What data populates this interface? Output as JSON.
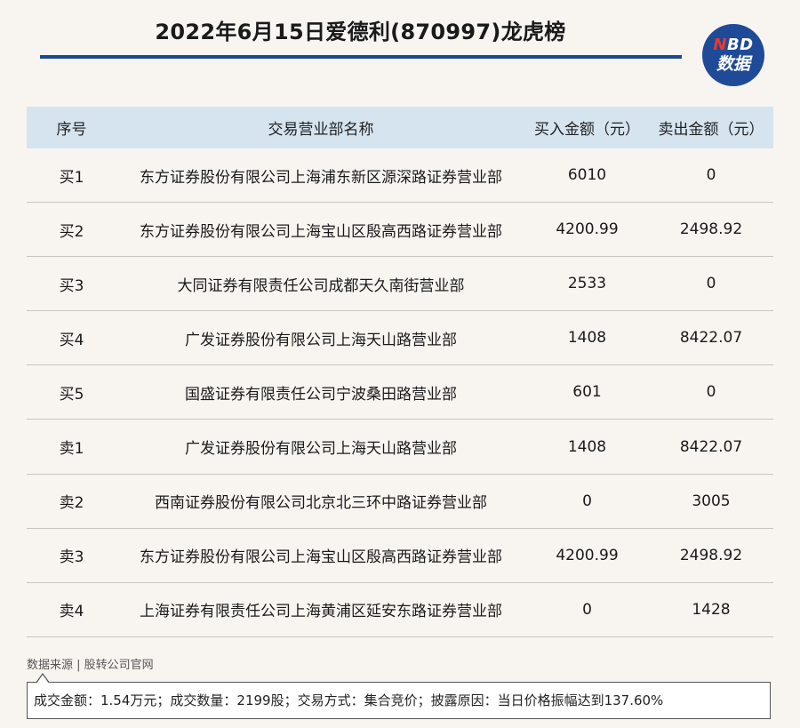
{
  "title": "2022年6月15日爱德利(870997)龙虎榜",
  "logo": {
    "n": "N",
    "bd": "BD",
    "sub": "数据"
  },
  "table": {
    "headers": [
      "序号",
      "交易营业部名称",
      "买入金额（元）",
      "卖出金额（元）"
    ],
    "rows": [
      {
        "seq": "买1",
        "name": "东方证券股份有限公司上海浦东新区源深路证券营业部",
        "buy": "6010",
        "sell": "0"
      },
      {
        "seq": "买2",
        "name": "东方证券股份有限公司上海宝山区殷高西路证券营业部",
        "buy": "4200.99",
        "sell": "2498.92"
      },
      {
        "seq": "买3",
        "name": "大同证券有限责任公司成都天久南街营业部",
        "buy": "2533",
        "sell": "0"
      },
      {
        "seq": "买4",
        "name": "广发证券股份有限公司上海天山路营业部",
        "buy": "1408",
        "sell": "8422.07"
      },
      {
        "seq": "买5",
        "name": "国盛证券有限责任公司宁波桑田路营业部",
        "buy": "601",
        "sell": "0"
      },
      {
        "seq": "卖1",
        "name": "广发证券股份有限公司上海天山路营业部",
        "buy": "1408",
        "sell": "8422.07"
      },
      {
        "seq": "卖2",
        "name": "西南证券股份有限公司北京北三环中路证券营业部",
        "buy": "0",
        "sell": "3005"
      },
      {
        "seq": "卖3",
        "name": "东方证券股份有限公司上海宝山区殷高西路证券营业部",
        "buy": "4200.99",
        "sell": "2498.92"
      },
      {
        "seq": "卖4",
        "name": "上海证券有限责任公司上海黄浦区延安东路证券营业部",
        "buy": "0",
        "sell": "1428"
      }
    ]
  },
  "source": "数据来源 | 股转公司官网",
  "note": "成交金额：1.54万元；成交数量：2199股；交易方式：集合竞价；披露原因：当日价格振幅达到137.60%",
  "colors": {
    "accent": "#1d4691",
    "header_bg": "#d6e4ef",
    "logo_red": "#e8392f"
  }
}
